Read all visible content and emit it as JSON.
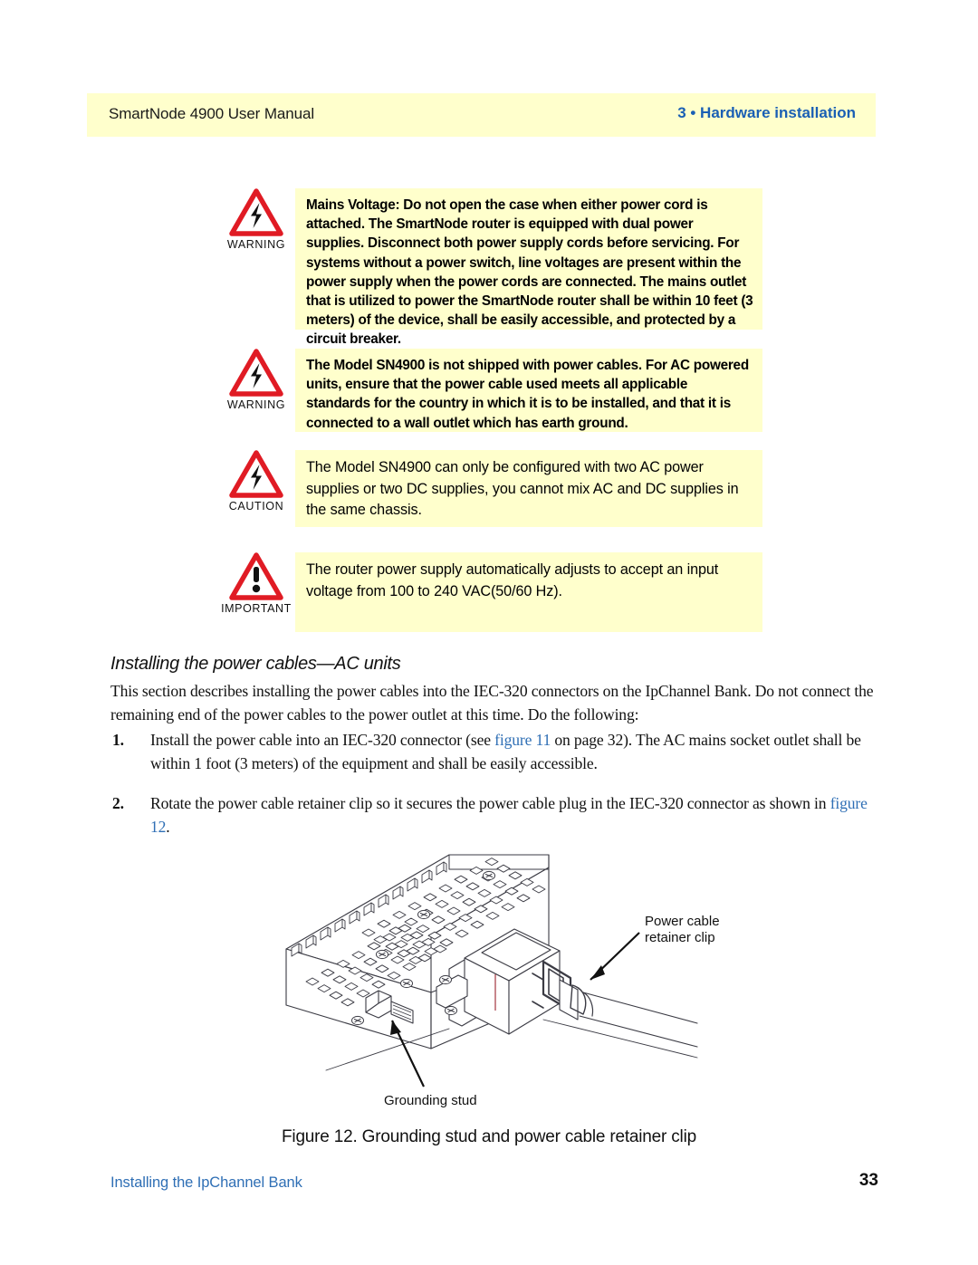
{
  "header": {
    "manual_title": "SmartNode 4900 User Manual",
    "chapter": "3 • Hardware installation",
    "band_color": "#ffffcc",
    "chapter_color": "#1a5fb4"
  },
  "admonitions": [
    {
      "label": "WARNING",
      "icon": "warning-lightning-triangle-icon",
      "style": "bold",
      "text": "Mains Voltage: Do not open the case when either power cord is attached. The SmartNode router is equipped with dual power supplies. Disconnect both power supply cords before servicing. For systems without a power switch, line voltages are present within the power supply when the power cords are connected. The mains outlet that is utilized to power the SmartNode router shall be within 10 feet (3 meters) of the device, shall be easily accessible, and protected by a circuit breaker."
    },
    {
      "label": "WARNING",
      "icon": "warning-lightning-triangle-icon",
      "style": "bold",
      "text": "The Model SN4900 is not shipped with power cables. For AC powered units, ensure that the power cable used meets all applicable standards for the country in which it is to be installed, and that it is connected to a wall outlet which has earth ground."
    },
    {
      "label": "CAUTION",
      "icon": "caution-lightning-triangle-icon",
      "style": "light",
      "text": "The Model SN4900 can only be configured with two AC power supplies or two DC supplies, you cannot mix AC and DC supplies in the same chassis."
    },
    {
      "label": "IMPORTANT",
      "icon": "important-exclamation-triangle-icon",
      "style": "light",
      "text": "The router power supply automatically adjusts to accept an input voltage from 100 to 240 VAC(50/60 Hz)."
    }
  ],
  "section": {
    "heading": "Installing the power cables—AC units",
    "intro": "This section describes installing the power cables into the IEC-320 connectors on the IpChannel Bank. Do not connect the remaining end of the power cables to the power outlet at this time. Do the following:"
  },
  "steps": [
    {
      "number": "1.",
      "part1": "Install the power cable into an IEC-320 connector (see ",
      "link": "figure 11",
      "part2": " on page 32). The AC mains socket outlet shall be within 1 foot (3 meters) of the equipment and shall be easily accessible."
    },
    {
      "number": "2.",
      "part1": "Rotate the power cable retainer clip so it secures the power cable plug in the IEC-320 connector as shown in ",
      "link": "figure 12",
      "part2": "."
    }
  ],
  "figure": {
    "caption": "Figure 12. Grounding stud and power cable retainer clip",
    "callout_retainer_line1": "Power cable",
    "callout_retainer_line2": "retainer clip",
    "callout_ground": "Grounding stud"
  },
  "footer": {
    "left": "Installing the IpChannel Bank",
    "page_number": "33",
    "left_color": "#2f6fb5"
  }
}
